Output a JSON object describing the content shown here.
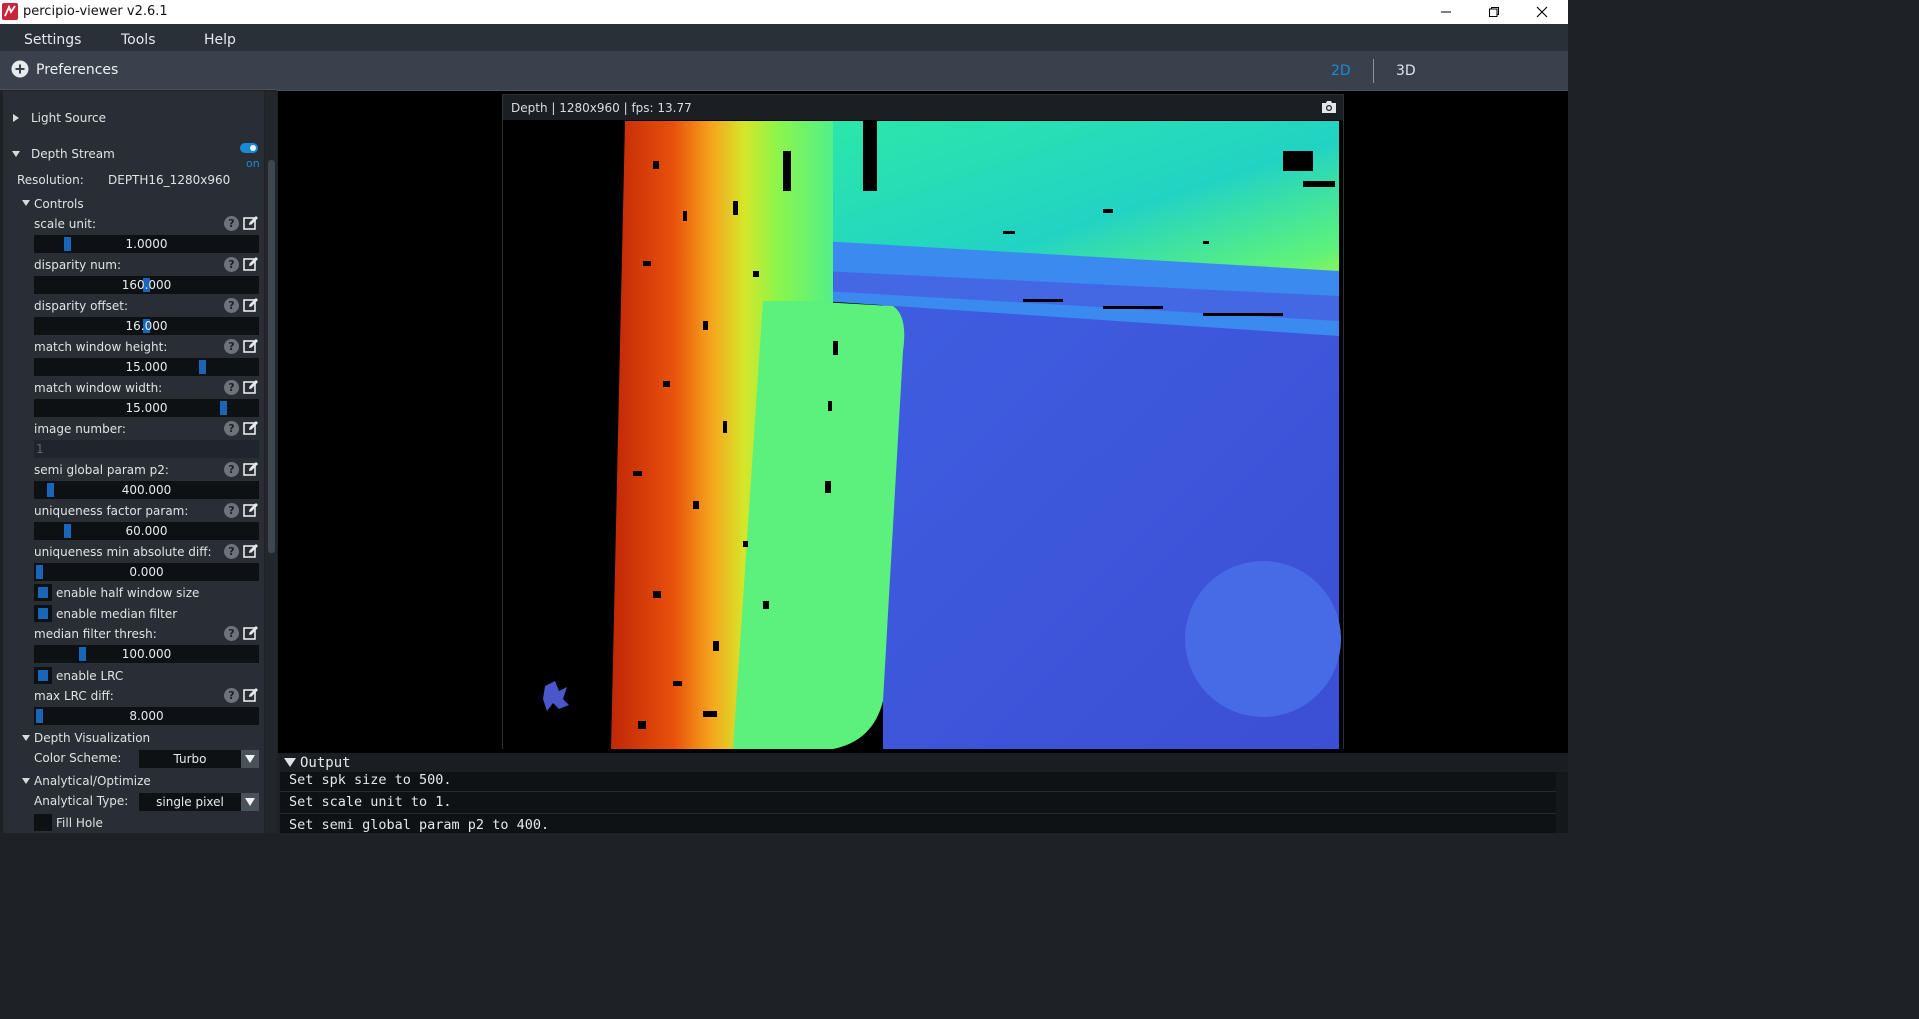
{
  "window": {
    "title": "percipio-viewer v2.6.1"
  },
  "menu": [
    "Settings",
    "Tools",
    "Help"
  ],
  "preferences": {
    "label": "Preferences"
  },
  "view_tabs": {
    "tab_2d": "2D",
    "tab_3d": "3D",
    "active": "2D",
    "active_color": "#1a8ad6"
  },
  "panel": {
    "light_source": "Light Source",
    "depth_stream": "Depth Stream",
    "depth_stream_toggle": "on",
    "resolution_label": "Resolution:",
    "resolution_value": "DEPTH16_1280x960",
    "controls": "Controls",
    "params": [
      {
        "label": "scale unit:",
        "value": "1.0000",
        "fill": 0.13
      },
      {
        "label": "disparity num:",
        "value": "160.000",
        "fill": 0.5
      },
      {
        "label": "disparity offset:",
        "value": "16.000",
        "fill": 0.5
      },
      {
        "label": "match window height:",
        "value": "15.000",
        "fill": 0.76
      },
      {
        "label": "match window width:",
        "value": "15.000",
        "fill": 0.86
      },
      {
        "label": "image number:",
        "value": "1",
        "fill": null
      },
      {
        "label": "semi global param p2:",
        "value": "400.000",
        "fill": 0.05
      },
      {
        "label": "uniqueness factor param:",
        "value": "60.000",
        "fill": 0.13
      },
      {
        "label": "uniqueness min absolute diff:",
        "value": "0.000",
        "fill": 0.0
      }
    ],
    "enable_half_window": "enable half window size",
    "enable_median": "enable median filter",
    "median_thresh": {
      "label": "median filter thresh:",
      "value": "100.000",
      "fill": 0.2
    },
    "enable_lrc": "enable LRC",
    "max_lrc": {
      "label": "max LRC diff:",
      "value": "8.000",
      "fill": 0.0
    },
    "depth_vis": "Depth Visualization",
    "color_scheme_label": "Color Scheme:",
    "color_scheme_value": "Turbo",
    "analytical": "Analytical/Optimize",
    "analytical_type_label": "Analytical Type:",
    "analytical_type_value": "single pixel",
    "fill_hole": "Fill Hole"
  },
  "depth_window": {
    "title": "Depth | 1280x960 | fps: 13.77"
  },
  "output": {
    "label": "Output",
    "lines": [
      "Set spk size to 500.",
      "Set scale unit to 1.",
      "Set semi global param p2 to 400."
    ]
  },
  "icons": [
    "app-logo-icon",
    "minimize-icon",
    "maximize-icon",
    "close-icon",
    "plus-circle-icon",
    "help-icon",
    "edit-icon",
    "camera-icon",
    "chevron-down-icon"
  ]
}
